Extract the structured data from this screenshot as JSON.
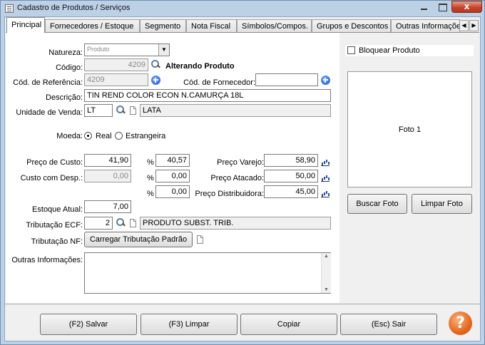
{
  "window": {
    "title": "Cadastro de Produtos / Serviços",
    "close_glyph": "x"
  },
  "tabs": [
    {
      "label": "Principal"
    },
    {
      "label": "Fornecedores / Estoque"
    },
    {
      "label": "Segmento"
    },
    {
      "label": "Nota Fiscal"
    },
    {
      "label": "Símbolos/Compos."
    },
    {
      "label": "Grupos e Descontos"
    },
    {
      "label": "Outras Informações"
    }
  ],
  "tab_scroll": {
    "left": "◀",
    "right": "▶"
  },
  "form": {
    "natureza_label": "Natureza:",
    "natureza_value": "Produto",
    "codigo_label": "Código:",
    "codigo_value": "4209",
    "status_text": "Alterando Produto",
    "cod_ref_label": "Cód. de Referência:",
    "cod_ref_value": "4209",
    "cod_forn_label": "Cód. de Fornecedor:",
    "cod_forn_value": "",
    "descricao_label": "Descrição:",
    "descricao_value": "TIN REND COLOR ECON N.CAMURÇA 18L",
    "unidade_label": "Unidade de Venda:",
    "unidade_code": "LT",
    "unidade_desc": "LATA",
    "moeda_label": "Moeda:",
    "moeda_real": "Real",
    "moeda_estrangeira": "Estrangeira",
    "preco_custo_label": "Preço de Custo:",
    "preco_custo_value": "41,90",
    "custo_desp_label": "Custo com Desp.:",
    "custo_desp_value": "0,00",
    "pct_symbol": "%",
    "pct_varejo": "40,57",
    "pct_atacado": "0,00",
    "pct_distribuidora": "0,00",
    "preco_varejo_label": "Preço Varejo:",
    "preco_varejo_value": "58,90",
    "preco_atacado_label": "Preço Atacado:",
    "preco_atacado_value": "50,00",
    "preco_distrib_label": "Preço Distribuidora:",
    "preco_distrib_value": "45,00",
    "estoque_label": "Estoque Atual:",
    "estoque_value": "7,00",
    "trib_ecf_label": "Tributação ECF:",
    "trib_ecf_code": "2",
    "trib_ecf_desc": "PRODUTO SUBST. TRIB.",
    "trib_nf_label": "Tributação NF:",
    "trib_nf_button": "Carregar Tributação Padrão",
    "outras_label": "Outras Informações:",
    "outras_value": ""
  },
  "side": {
    "bloquear_label": "Bloquear Produto",
    "foto_label": "Foto 1",
    "buscar_foto": "Buscar Foto",
    "limpar_foto": "Limpar Foto"
  },
  "footer": {
    "salvar": "(F2) Salvar",
    "limpar": "(F3) Limpar",
    "copiar": "Copiar",
    "sair": "(Esc) Sair",
    "help": "?"
  }
}
